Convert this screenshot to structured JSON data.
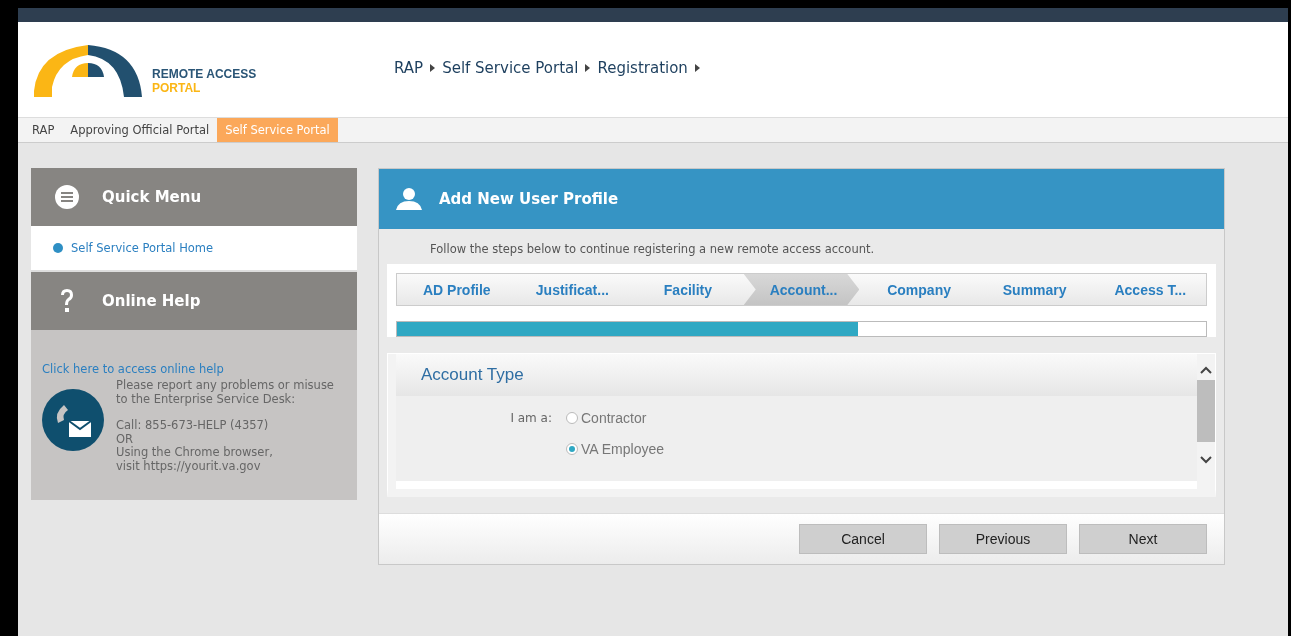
{
  "logo": {
    "line1": "REMOTE ACCESS",
    "line2": "PORTAL"
  },
  "breadcrumb": [
    "RAP",
    "Self Service Portal",
    "Registration"
  ],
  "nav_tabs": [
    {
      "label": "RAP",
      "selected": false
    },
    {
      "label": "Approving Official Portal",
      "selected": false
    },
    {
      "label": "Self Service Portal",
      "selected": true
    }
  ],
  "sidebar": {
    "quick_menu": {
      "title": "Quick Menu",
      "items": [
        "Self Service Portal Home"
      ]
    },
    "online_help": {
      "title": "Online Help",
      "link": "Click here to access online help",
      "report": [
        "Please report any problems or misuse",
        "to the Enterprise Service Desk:"
      ],
      "contact": [
        "Call: 855-673-HELP (4357)",
        "OR",
        "Using the Chrome browser,",
        "visit https://yourit.va.gov"
      ]
    }
  },
  "panel": {
    "title": "Add New User Profile",
    "intro": "Follow the steps below to continue registering a new remote access account.",
    "steps": [
      {
        "label": "AD Profile",
        "selected": false
      },
      {
        "label": "Justificat...",
        "selected": false
      },
      {
        "label": "Facility",
        "selected": false
      },
      {
        "label": "Account...",
        "selected": true
      },
      {
        "label": "Company",
        "selected": false
      },
      {
        "label": "Summary",
        "selected": false
      },
      {
        "label": "Access T...",
        "selected": false
      }
    ],
    "progress": {
      "level": 0.57
    },
    "section": {
      "title": "Account Type",
      "field_label": "I am a:",
      "options": [
        {
          "label": "Contractor",
          "selected": false
        },
        {
          "label": "VA Employee",
          "selected": true
        }
      ]
    },
    "buttons": [
      "Cancel",
      "Previous",
      "Next"
    ]
  }
}
